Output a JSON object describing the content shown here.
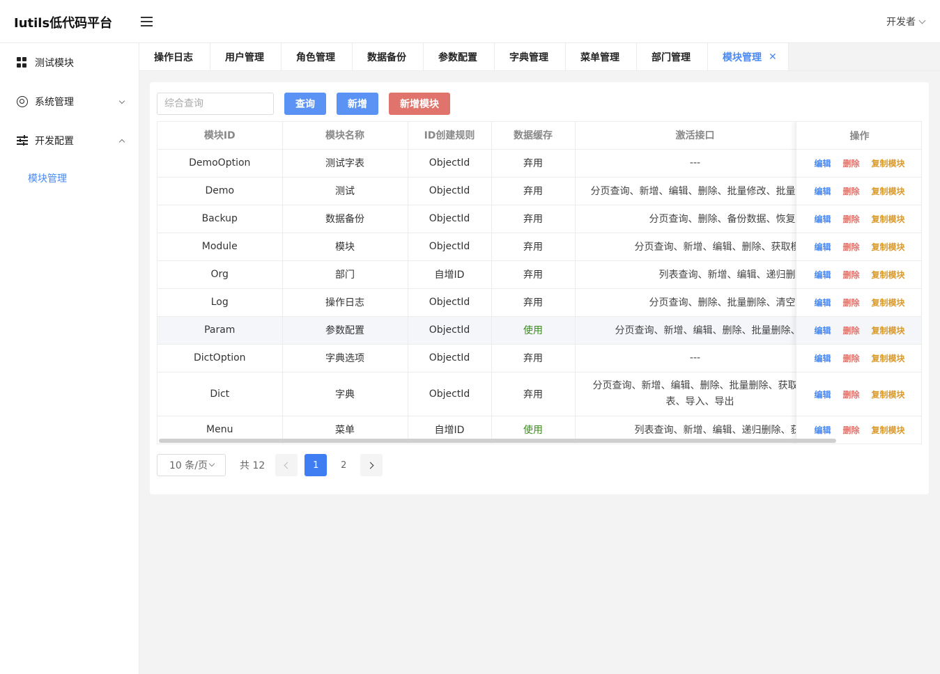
{
  "app": {
    "title": "Iutils低代码平台",
    "user": "开发者"
  },
  "sidebar": {
    "items": [
      {
        "label": "测试模块",
        "icon": "grid-icon"
      },
      {
        "label": "系统管理",
        "icon": "gear-icon",
        "expanded": false
      },
      {
        "label": "开发配置",
        "icon": "sliders-icon",
        "expanded": true
      }
    ],
    "sub_item": "模块管理"
  },
  "tabs": [
    "操作日志",
    "用户管理",
    "角色管理",
    "数据备份",
    "参数配置",
    "字典管理",
    "菜单管理",
    "部门管理",
    "模块管理"
  ],
  "active_tab": "模块管理",
  "toolbar": {
    "search_placeholder": "综合查询",
    "query_label": "查询",
    "add_label": "新增",
    "add_module_label": "新增模块"
  },
  "colors": {
    "primary": "#5b93f5",
    "danger": "#e0736c",
    "warning": "#d99a2b",
    "success": "#3a8a1c"
  },
  "table": {
    "columns": [
      "模块ID",
      "模块名称",
      "ID创建规则",
      "数据缓存",
      "激活接口",
      "操作"
    ],
    "rows": [
      {
        "id": "DemoOption",
        "name": "测试字表",
        "rule": "ObjectId",
        "cache": "弃用",
        "api": "---"
      },
      {
        "id": "Demo",
        "name": "测试",
        "rule": "ObjectId",
        "cache": "弃用",
        "api": "分页查询、新增、编辑、删除、批量修改、批量删除"
      },
      {
        "id": "Backup",
        "name": "数据备份",
        "rule": "ObjectId",
        "cache": "弃用",
        "api": "分页查询、删除、备份数据、恢复数据"
      },
      {
        "id": "Module",
        "name": "模块",
        "rule": "ObjectId",
        "cache": "弃用",
        "api": "分页查询、新增、编辑、删除、获取模块"
      },
      {
        "id": "Org",
        "name": "部门",
        "rule": "自增ID",
        "cache": "弃用",
        "api": "列表查询、新增、编辑、递归删除"
      },
      {
        "id": "Log",
        "name": "操作日志",
        "rule": "ObjectId",
        "cache": "弃用",
        "api": "分页查询、删除、批量删除、清空日志"
      },
      {
        "id": "Param",
        "name": "参数配置",
        "rule": "ObjectId",
        "cache": "使用",
        "api": "分页查询、新增、编辑、删除、批量删除、"
      },
      {
        "id": "DictOption",
        "name": "字典选项",
        "rule": "ObjectId",
        "cache": "弃用",
        "api": "---"
      },
      {
        "id": "Dict",
        "name": "字典",
        "rule": "ObjectId",
        "cache": "弃用",
        "api": "分页查询、新增、编辑、删除、批量删除、获取列表、导入、导出"
      },
      {
        "id": "Menu",
        "name": "菜单",
        "rule": "自增ID",
        "cache": "使用",
        "api": "列表查询、新增、编辑、递归删除、获取"
      }
    ],
    "ops": {
      "edit": "编辑",
      "delete": "删除",
      "copy": "复制模块"
    }
  },
  "pagination": {
    "page_size": "10 条/页",
    "total": "共 12",
    "pages": [
      "1",
      "2"
    ],
    "current": "1"
  }
}
